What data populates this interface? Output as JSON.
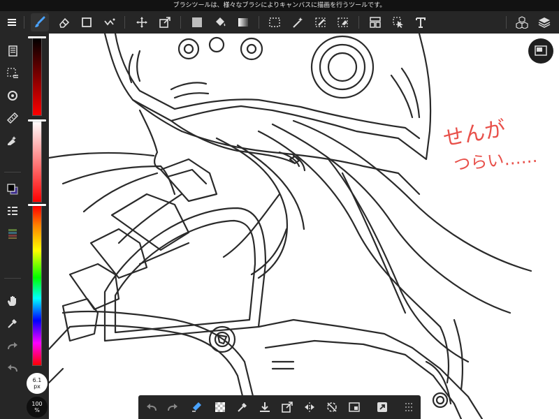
{
  "hint_bar": {
    "text": "ブラシツールは、様々なブラシによりキャンバスに描画を行うツールです。"
  },
  "top_toolbar": {
    "tools": [
      {
        "name": "brush-tool",
        "icon": "brush-icon",
        "active": true
      },
      {
        "name": "eraser-tool",
        "icon": "eraser-icon"
      },
      {
        "name": "shape-tool",
        "icon": "square-icon"
      },
      {
        "name": "smudge-tool",
        "icon": "smudge-icon"
      },
      {
        "name": "move-tool",
        "icon": "move-icon"
      },
      {
        "name": "transform-tool",
        "icon": "transform-icon"
      },
      {
        "name": "fill-color-tool",
        "icon": "fill-color-icon"
      },
      {
        "name": "bucket-tool",
        "icon": "bucket-icon"
      },
      {
        "name": "gradient-tool",
        "icon": "gradient-icon"
      },
      {
        "name": "selection-tool",
        "icon": "selection-icon"
      },
      {
        "name": "magic-wand-tool",
        "icon": "magic-wand-icon"
      },
      {
        "name": "select-pen-tool",
        "icon": "select-pen-icon"
      },
      {
        "name": "select-eraser-tool",
        "icon": "select-eraser-icon"
      },
      {
        "name": "frame-divider-tool",
        "icon": "frame-icon"
      },
      {
        "name": "operation-tool",
        "icon": "cursor-icon"
      },
      {
        "name": "text-tool",
        "icon": "text-icon",
        "label": "T"
      }
    ],
    "right": [
      {
        "name": "material-button",
        "icon": "cubes-icon"
      },
      {
        "name": "layers-button",
        "icon": "layers-icon"
      }
    ]
  },
  "left_bar": {
    "items": [
      {
        "name": "menu-button",
        "icon": "hamburger-icon"
      },
      {
        "name": "pages-button",
        "icon": "pages-icon"
      },
      {
        "name": "select-menu-button",
        "icon": "select-layer-icon"
      },
      {
        "name": "snap-button",
        "icon": "snap-icon"
      },
      {
        "name": "ruler-button",
        "icon": "ruler-icon"
      },
      {
        "name": "filter-button",
        "icon": "filter-icon"
      },
      {
        "name": "color-swatch",
        "icon": "color-swatch-icon"
      },
      {
        "name": "layer-properties-button",
        "icon": "layer-properties-icon"
      },
      {
        "name": "palette-button",
        "icon": "palette-icon"
      },
      {
        "name": "hand-tool-button",
        "icon": "hand-icon"
      },
      {
        "name": "eyedropper-button",
        "icon": "eyedropper-icon"
      },
      {
        "name": "redo-button",
        "icon": "redo-icon"
      },
      {
        "name": "undo-button",
        "icon": "undo-icon"
      }
    ]
  },
  "brush": {
    "size_value": "6.1",
    "size_unit": "px",
    "opacity_value": "100",
    "opacity_unit": "%"
  },
  "colors": {
    "primary": "#000000",
    "secondary": "#3a2a8c",
    "accent_annotation": "#e8504a",
    "toolbar_bg": "#262626"
  },
  "canvas": {
    "annotation_line1": "せんが",
    "annotation_line2": "つらい……"
  },
  "bottom_bar": {
    "items": [
      {
        "name": "undo-button",
        "icon": "undo-icon"
      },
      {
        "name": "redo-button",
        "icon": "redo-icon"
      },
      {
        "name": "eraser-toggle-button",
        "icon": "eraser-toggle-icon"
      },
      {
        "name": "transparent-color-button",
        "icon": "transparent-icon"
      },
      {
        "name": "eyedropper-button",
        "icon": "eyedropper-icon"
      },
      {
        "name": "save-button",
        "icon": "download-icon"
      },
      {
        "name": "transform-button",
        "icon": "transform-icon"
      },
      {
        "name": "flip-button",
        "icon": "flip-icon"
      },
      {
        "name": "rotate-reset-button",
        "icon": "rotate-reset-icon"
      },
      {
        "name": "fit-view-button",
        "icon": "fit-icon"
      },
      {
        "name": "share-button",
        "icon": "share-icon"
      },
      {
        "name": "more-button",
        "icon": "grid-dots-icon"
      }
    ]
  }
}
